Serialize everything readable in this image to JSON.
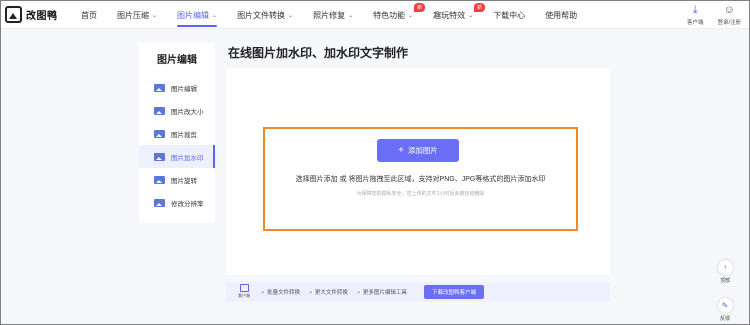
{
  "brand": {
    "name": "改图鸭"
  },
  "nav": {
    "items": [
      {
        "label": "首页",
        "chevron": false,
        "badge": ""
      },
      {
        "label": "图片压缩",
        "chevron": true,
        "badge": ""
      },
      {
        "label": "图片编辑",
        "chevron": true,
        "badge": "",
        "active": true
      },
      {
        "label": "图片文件转换",
        "chevron": true,
        "badge": ""
      },
      {
        "label": "照片修复",
        "chevron": true,
        "badge": ""
      },
      {
        "label": "特色功能",
        "chevron": true,
        "badge": "新"
      },
      {
        "label": "趣玩特效",
        "chevron": true,
        "badge": "新"
      },
      {
        "label": "下载中心",
        "chevron": false,
        "badge": ""
      },
      {
        "label": "使用帮助",
        "chevron": false,
        "badge": ""
      }
    ],
    "right": {
      "client_label": "客户端",
      "login_label": "登录/注册"
    }
  },
  "sidebar": {
    "title": "图片编辑",
    "items": [
      {
        "label": "图片编辑"
      },
      {
        "label": "图片改大小"
      },
      {
        "label": "图片裁剪"
      },
      {
        "label": "图片加水印",
        "active": true
      },
      {
        "label": "图片旋转"
      },
      {
        "label": "修改分辨率"
      }
    ]
  },
  "main": {
    "title": "在线图片加水印、加水印文字制作",
    "add_button": "添加图片",
    "add_icon": "plus-icon",
    "hint": "选择图片添加 或 将图片拖拽至此区域，支持对PNG、JPG等格式的图片添加水印",
    "sub_hint": "为保障您的隐私安全，您上传的文件1小时后会被自动删除"
  },
  "promo": {
    "icon_label": "客户端",
    "features": [
      "批量文件转换",
      "更大文件转换",
      "更多图片编辑工具"
    ],
    "button": "下载改图鸭客户端"
  },
  "floating": {
    "top_label": "顶部",
    "feedback_label": "反馈"
  },
  "colors": {
    "accent": "#5b63f5",
    "button": "#6a6ff5",
    "dropzone_border": "#f08a1c",
    "badge": "#f33e3e"
  }
}
